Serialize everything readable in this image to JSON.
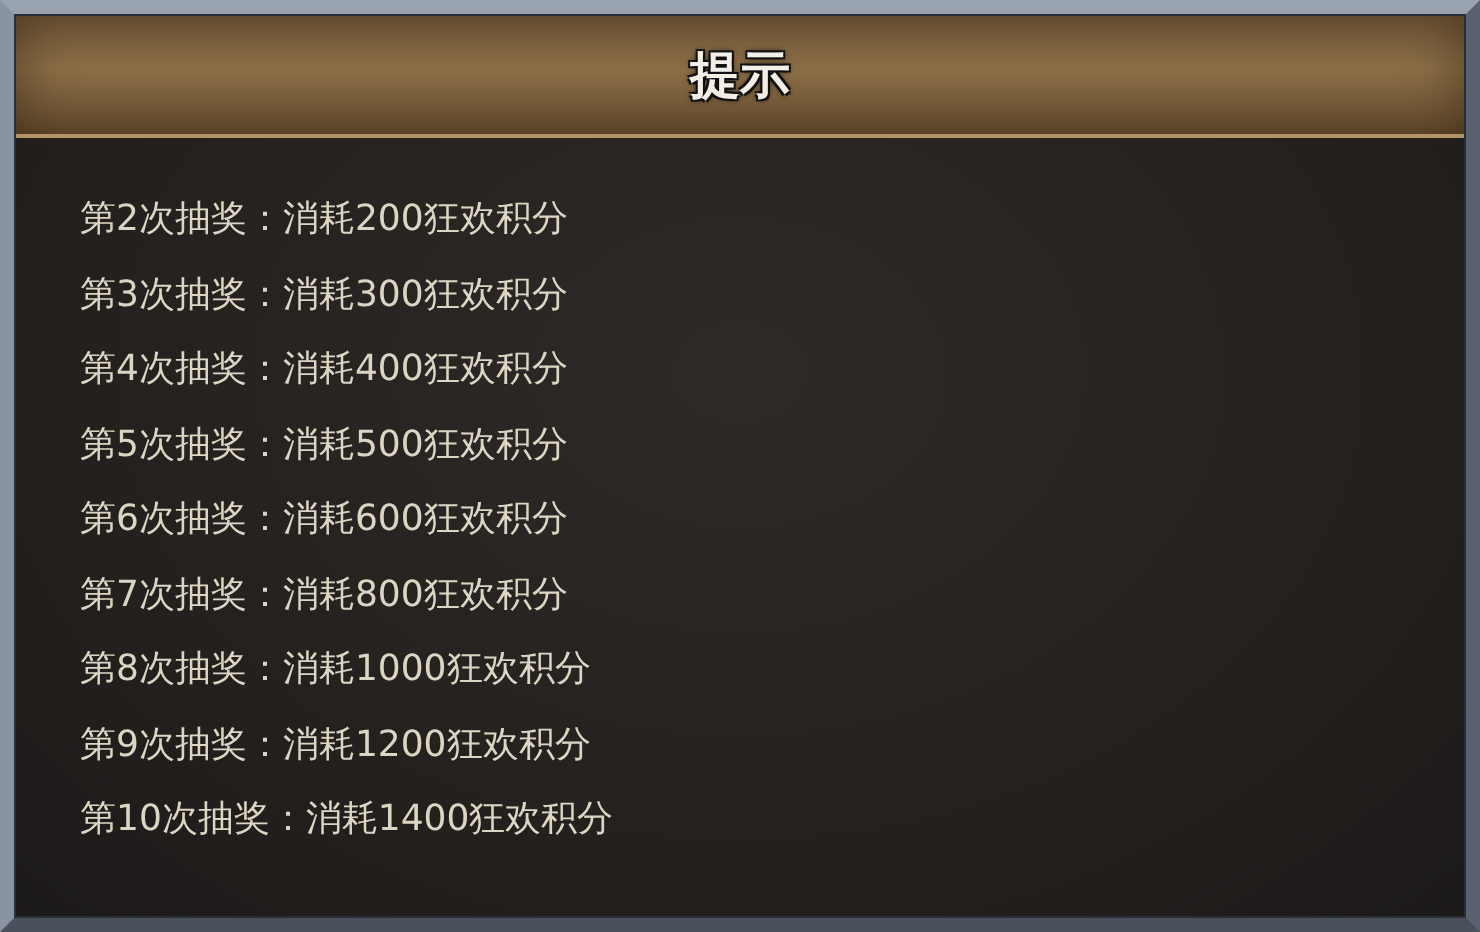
{
  "dialog": {
    "title": "提示",
    "lines": [
      "第2次抽奖：消耗200狂欢积分",
      "第3次抽奖：消耗300狂欢积分",
      "第4次抽奖：消耗400狂欢积分",
      "第5次抽奖：消耗500狂欢积分",
      "第6次抽奖：消耗600狂欢积分",
      "第7次抽奖：消耗800狂欢积分",
      "第8次抽奖：消耗1000狂欢积分",
      "第9次抽奖：消耗1200狂欢积分",
      "第10次抽奖：消耗1400狂欢积分"
    ]
  }
}
